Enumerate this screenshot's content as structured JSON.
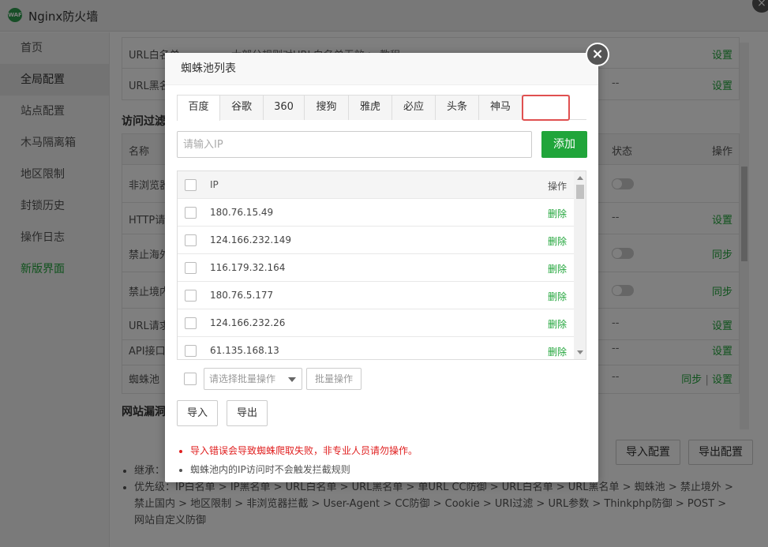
{
  "app": {
    "title": "Nginx防火墙",
    "logo_text": "WAF"
  },
  "sidebar": {
    "items": [
      {
        "label": "首页"
      },
      {
        "label": "全局配置"
      },
      {
        "label": "站点配置"
      },
      {
        "label": "木马隔离箱"
      },
      {
        "label": "地区限制"
      },
      {
        "label": "封锁历史"
      },
      {
        "label": "操作日志"
      },
      {
        "label": "新版界面"
      }
    ]
  },
  "main": {
    "rows_top": [
      {
        "name": "URL白名单",
        "desc": "大部分规则对URL白名单无效 > 教程",
        "status": "--",
        "op": "设置"
      },
      {
        "name": "URL黑名单",
        "status": "--",
        "op": "设置"
      }
    ],
    "section_filter": "访问过滤",
    "table_header": {
      "name": "名称",
      "status": "状态",
      "op": "操作"
    },
    "rows": [
      {
        "name": "非浏览器",
        "op": ""
      },
      {
        "name": "HTTP请求",
        "status": "--",
        "op": "设置"
      },
      {
        "name": "禁止海外",
        "op": "同步"
      },
      {
        "name": "禁止境内",
        "op": "同步"
      },
      {
        "name": "URL请求",
        "status": "--",
        "op": "设置"
      },
      {
        "name": "API接口",
        "status": "--",
        "op": "设置"
      },
      {
        "name": "蜘蛛池",
        "status": "--",
        "op_sync": "同步",
        "op_sep": "|",
        "op_set": "设置"
      }
    ],
    "section_vuln": "网站漏洞",
    "buttons": {
      "import_config": "导入配置",
      "export_config": "导出配置"
    },
    "notes": [
      "继承：",
      "优先级：IP白名单 > IP黑名单 > URL白名单 > URL黑名单 > 单URL CC防御 > URL白名单 > URL黑名单 > 蜘蛛池 > 禁止境外 > 禁止国内 > 地区限制 > 非浏览器拦截 > User-Agent > CC防御 > Cookie > URI过滤 > URL参数 > Thinkphp防御 > POST > 网站自定义防御"
    ]
  },
  "modal": {
    "title": "蜘蛛池列表",
    "tabs": [
      "百度",
      "谷歌",
      "360",
      "搜狗",
      "雅虎",
      "必应",
      "头条",
      "神马",
      ""
    ],
    "active_tab": 0,
    "input_placeholder": "请输入IP",
    "add_label": "添加",
    "table": {
      "col_ip": "IP",
      "col_op": "操作",
      "rows": [
        {
          "ip": "180.76.15.49",
          "op": "删除"
        },
        {
          "ip": "124.166.232.149",
          "op": "删除"
        },
        {
          "ip": "116.179.32.164",
          "op": "删除"
        },
        {
          "ip": "180.76.5.177",
          "op": "删除"
        },
        {
          "ip": "124.166.232.26",
          "op": "删除"
        },
        {
          "ip": "61.135.168.13",
          "op": "删除"
        }
      ]
    },
    "batch_select_placeholder": "请选择批量操作",
    "batch_btn": "批量操作",
    "import_label": "导入",
    "export_label": "导出",
    "notes": {
      "warning": "导入错误会导致蜘蛛爬取失败，非专业人员请勿操作。",
      "info": "蜘蛛池内的IP访问时不会触发拦截规则"
    },
    "colors": {
      "accent": "#20a53a",
      "warning": "#e02020",
      "highlight": "#e05050"
    }
  }
}
